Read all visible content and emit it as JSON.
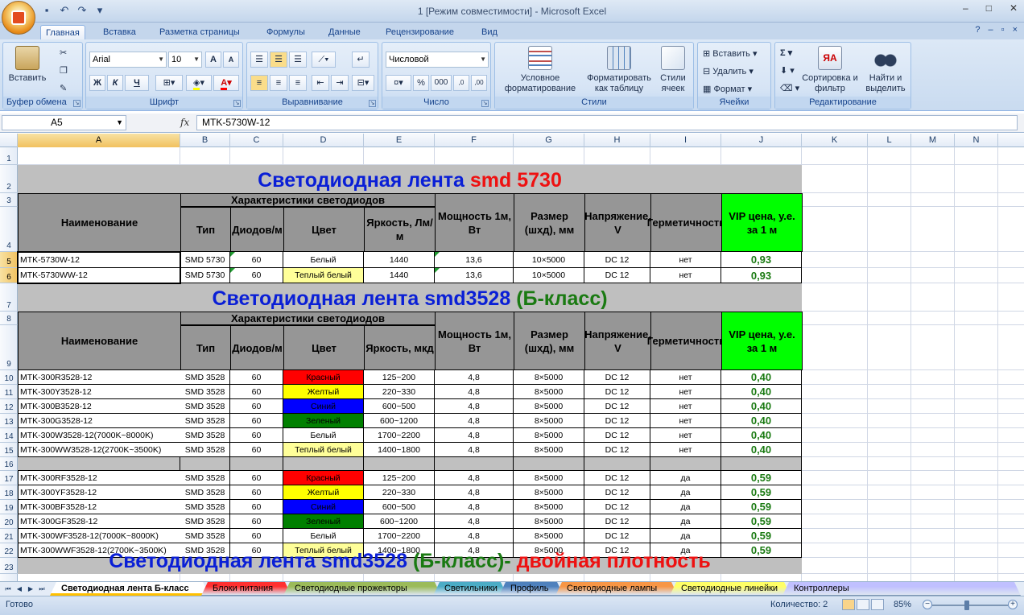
{
  "window": {
    "title": "1  [Режим совместимости] - Microsoft Excel",
    "minimize": "–",
    "maximize": "□",
    "close": "✕"
  },
  "ribbon_tabs": [
    "Главная",
    "Вставка",
    "Разметка страницы",
    "Формулы",
    "Данные",
    "Рецензирование",
    "Вид"
  ],
  "ribbon": {
    "clipboard": {
      "title": "Буфер обмена",
      "paste": "Вставить"
    },
    "font": {
      "title": "Шрифт",
      "font_name": "Arial",
      "font_size": "10",
      "bold": "Ж",
      "italic": "К",
      "underline": "Ч"
    },
    "alignment": {
      "title": "Выравнивание"
    },
    "number": {
      "title": "Число",
      "format": "Числовой",
      "percent": "%",
      "thousands": "000"
    },
    "styles": {
      "title": "Стили",
      "conditional": "Условное форматирование",
      "as_table": "Форматировать как таблицу",
      "cell_styles": "Стили ячеек"
    },
    "cells": {
      "title": "Ячейки",
      "insert": "Вставить",
      "delete": "Удалить",
      "format": "Формат"
    },
    "editing": {
      "title": "Редактирование",
      "sort": "Сортировка и фильтр",
      "find": "Найти и выделить",
      "sum": "Σ"
    }
  },
  "formula_bar": {
    "name_box": "A5",
    "fx": "fx",
    "value": "MTK-5730W-12"
  },
  "columns": [
    "A",
    "B",
    "C",
    "D",
    "E",
    "F",
    "G",
    "H",
    "I",
    "J",
    "K",
    "L",
    "M",
    "N"
  ],
  "rows": [
    "1",
    "2",
    "3",
    "4",
    "5",
    "6",
    "7",
    "8",
    "9",
    "10",
    "11",
    "12",
    "13",
    "14",
    "15",
    "16",
    "17",
    "18",
    "19",
    "20",
    "21",
    "22",
    "23"
  ],
  "sections": [
    {
      "title_parts": [
        {
          "text": "Светодиодная лента ",
          "color": "blue"
        },
        {
          "text": "smd 5730",
          "color": "red"
        }
      ]
    },
    {
      "title_parts": [
        {
          "text": "Светодиодная лента smd3528 ",
          "color": "blue"
        },
        {
          "text": "(Б-класс)",
          "color": "green"
        }
      ]
    },
    {
      "title_parts": [
        {
          "text": "Светодиодная лента smd3528 ",
          "color": "blue"
        },
        {
          "text": "(Б-класс)- ",
          "color": "green"
        },
        {
          "text": "двойная плотность",
          "color": "red"
        }
      ]
    }
  ],
  "headers": {
    "name": "Наименование",
    "characteristics": "Характеристики светодиодов",
    "type": "Тип",
    "diodes": "Диодов/м",
    "color": "Цвет",
    "brightness_1": "Яркость, Лм/м",
    "brightness_2": "Яркость, мкд",
    "power": "Мощность 1м, Вт",
    "size": "Размер (шхд), мм",
    "voltage": "Напряжение, V",
    "sealed": "Герметичность",
    "vip": "VIP цена, у.е. за 1 м"
  },
  "table1": [
    {
      "name": "MTK-5730W-12",
      "type": "SMD 5730",
      "diodes": "60",
      "color": "Белый",
      "color_bg": "#ffffff",
      "bright": "1440",
      "power": "13,6",
      "size": "10×5000",
      "volt": "DC 12",
      "sealed": "нет",
      "price": "0,93"
    },
    {
      "name": "MTK-5730WW-12",
      "type": "SMD 5730",
      "diodes": "60",
      "color": "Теплый белый",
      "color_bg": "#ffff99",
      "bright": "1440",
      "power": "13,6",
      "size": "10×5000",
      "volt": "DC 12",
      "sealed": "нет",
      "price": "0,93"
    }
  ],
  "table2": [
    {
      "name": "MTK-300R3528-12",
      "type": "SMD 3528",
      "diodes": "60",
      "color": "Красный",
      "color_bg": "#ff0000",
      "bright": "125~200",
      "power": "4,8",
      "size": "8×5000",
      "volt": "DC 12",
      "sealed": "нет",
      "price": "0,40"
    },
    {
      "name": "MTK-300Y3528-12",
      "type": "SMD 3528",
      "diodes": "60",
      "color": "Желтый",
      "color_bg": "#ffff00",
      "bright": "220~330",
      "power": "4,8",
      "size": "8×5000",
      "volt": "DC 12",
      "sealed": "нет",
      "price": "0,40"
    },
    {
      "name": "MTK-300B3528-12",
      "type": "SMD 3528",
      "diodes": "60",
      "color": "Синий",
      "color_bg": "#0000ff",
      "bright": "600~500",
      "power": "4,8",
      "size": "8×5000",
      "volt": "DC 12",
      "sealed": "нет",
      "price": "0,40"
    },
    {
      "name": "MTK-300G3528-12",
      "type": "SMD 3528",
      "diodes": "60",
      "color": "Зеленый",
      "color_bg": "#008000",
      "bright": "600~1200",
      "power": "4,8",
      "size": "8×5000",
      "volt": "DC 12",
      "sealed": "нет",
      "price": "0,40"
    },
    {
      "name": "MTK-300W3528-12(7000K~8000K)",
      "type": "SMD 3528",
      "diodes": "60",
      "color": "Белый",
      "color_bg": "#ffffff",
      "bright": "1700~2200",
      "power": "4,8",
      "size": "8×5000",
      "volt": "DC 12",
      "sealed": "нет",
      "price": "0,40"
    },
    {
      "name": "MTK-300WW3528-12(2700K~3500K)",
      "type": "SMD 3528",
      "diodes": "60",
      "color": "Теплый белый",
      "color_bg": "#ffff99",
      "bright": "1400~1800",
      "power": "4,8",
      "size": "8×5000",
      "volt": "DC 12",
      "sealed": "нет",
      "price": "0,40"
    }
  ],
  "table3": [
    {
      "name": "MTK-300RF3528-12",
      "type": "SMD 3528",
      "diodes": "60",
      "color": "Красный",
      "color_bg": "#ff0000",
      "bright": "125~200",
      "power": "4,8",
      "size": "8×5000",
      "volt": "DC 12",
      "sealed": "да",
      "price": "0,59"
    },
    {
      "name": "MTK-300YF3528-12",
      "type": "SMD 3528",
      "diodes": "60",
      "color": "Желтый",
      "color_bg": "#ffff00",
      "bright": "220~330",
      "power": "4,8",
      "size": "8×5000",
      "volt": "DC 12",
      "sealed": "да",
      "price": "0,59"
    },
    {
      "name": "MTK-300BF3528-12",
      "type": "SMD 3528",
      "diodes": "60",
      "color": "Синий",
      "color_bg": "#0000ff",
      "bright": "600~500",
      "power": "4,8",
      "size": "8×5000",
      "volt": "DC 12",
      "sealed": "да",
      "price": "0,59"
    },
    {
      "name": "MTK-300GF3528-12",
      "type": "SMD 3528",
      "diodes": "60",
      "color": "Зеленый",
      "color_bg": "#008000",
      "bright": "600~1200",
      "power": "4,8",
      "size": "8×5000",
      "volt": "DC 12",
      "sealed": "да",
      "price": "0,59"
    },
    {
      "name": "MTK-300WF3528-12(7000K~8000K)",
      "type": "SMD 3528",
      "diodes": "60",
      "color": "Белый",
      "color_bg": "#ffffff",
      "bright": "1700~2200",
      "power": "4,8",
      "size": "8×5000",
      "volt": "DC 12",
      "sealed": "да",
      "price": "0,59"
    },
    {
      "name": "MTK-300WWF3528-12(2700K~3500K)",
      "type": "SMD 3528",
      "diodes": "60",
      "color": "Теплый белый",
      "color_bg": "#ffff99",
      "bright": "1400~1800",
      "power": "4,8",
      "size": "8×5000",
      "volt": "DC 12",
      "sealed": "да",
      "price": "0,59"
    }
  ],
  "sheet_tabs": [
    {
      "label": "Светодиодная лента Б-класс",
      "color": "#ffffff",
      "active": true
    },
    {
      "label": "Блоки питания",
      "color": "#ff3030",
      "active": false
    },
    {
      "label": "Светодиодные прожекторы",
      "color": "#9bbb59",
      "active": false
    },
    {
      "label": "Светильники",
      "color": "#4bacc6",
      "active": false
    },
    {
      "label": "Профиль",
      "color": "#4f81bd",
      "active": false
    },
    {
      "label": "Светодиодные лампы",
      "color": "#f79646",
      "active": false
    },
    {
      "label": "Светодиодные линейки",
      "color": "#ffff66",
      "active": false
    },
    {
      "label": "Контроллеры",
      "color": "#c0c0ff",
      "active": false
    }
  ],
  "status": {
    "ready": "Готово",
    "count": "Количество: 2",
    "zoom": "85%"
  }
}
